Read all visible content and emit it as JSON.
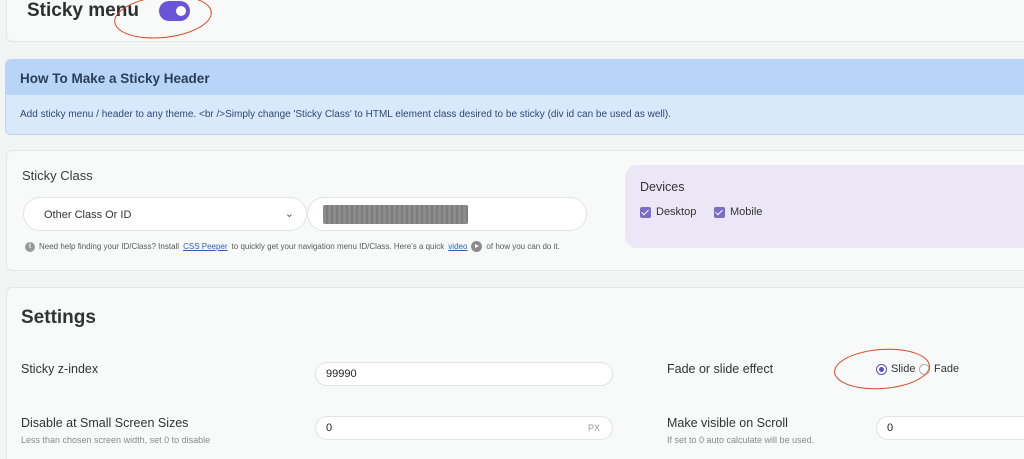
{
  "top": {
    "title": "Sticky menu",
    "toggle_on": true
  },
  "info": {
    "heading": "How To Make a Sticky Header",
    "body": "Add sticky menu / header to any theme. <br />Simply change 'Sticky Class' to HTML element class desired to be sticky (div id can be used as well)."
  },
  "sticky_class": {
    "label": "Sticky Class",
    "select_value": "Other Class Or ID",
    "help_prefix": "Need help finding your ID/Class? Install",
    "help_link": "CSS Peeper",
    "help_middle": "to quickly get your navigation menu ID/Class. Here's a quick",
    "help_video_link": "video",
    "help_suffix": "of how you can do it."
  },
  "devices": {
    "label": "Devices",
    "options": [
      {
        "label": "Desktop",
        "checked": true
      },
      {
        "label": "Mobile",
        "checked": true
      }
    ]
  },
  "settings": {
    "title": "Settings",
    "z_index": {
      "label": "Sticky z-index",
      "value": "99990"
    },
    "disable_small": {
      "label": "Disable at Small Screen Sizes",
      "hint": "Less than chosen screen width, set 0 to disable",
      "value": "0",
      "unit": "PX"
    },
    "effect": {
      "label": "Fade or slide effect",
      "options": [
        "Slide",
        "Fade"
      ],
      "selected": "Slide"
    },
    "visible_scroll": {
      "label": "Make visible on Scroll",
      "hint": "If set to 0 auto calculate will be used.",
      "value": "0"
    }
  },
  "colors": {
    "accent": "#6a55d8",
    "annotation": "#d9441d",
    "info_header": "#b8d4f7",
    "info_body": "#d9e8fb",
    "devices_bg": "#ebe7f6"
  }
}
